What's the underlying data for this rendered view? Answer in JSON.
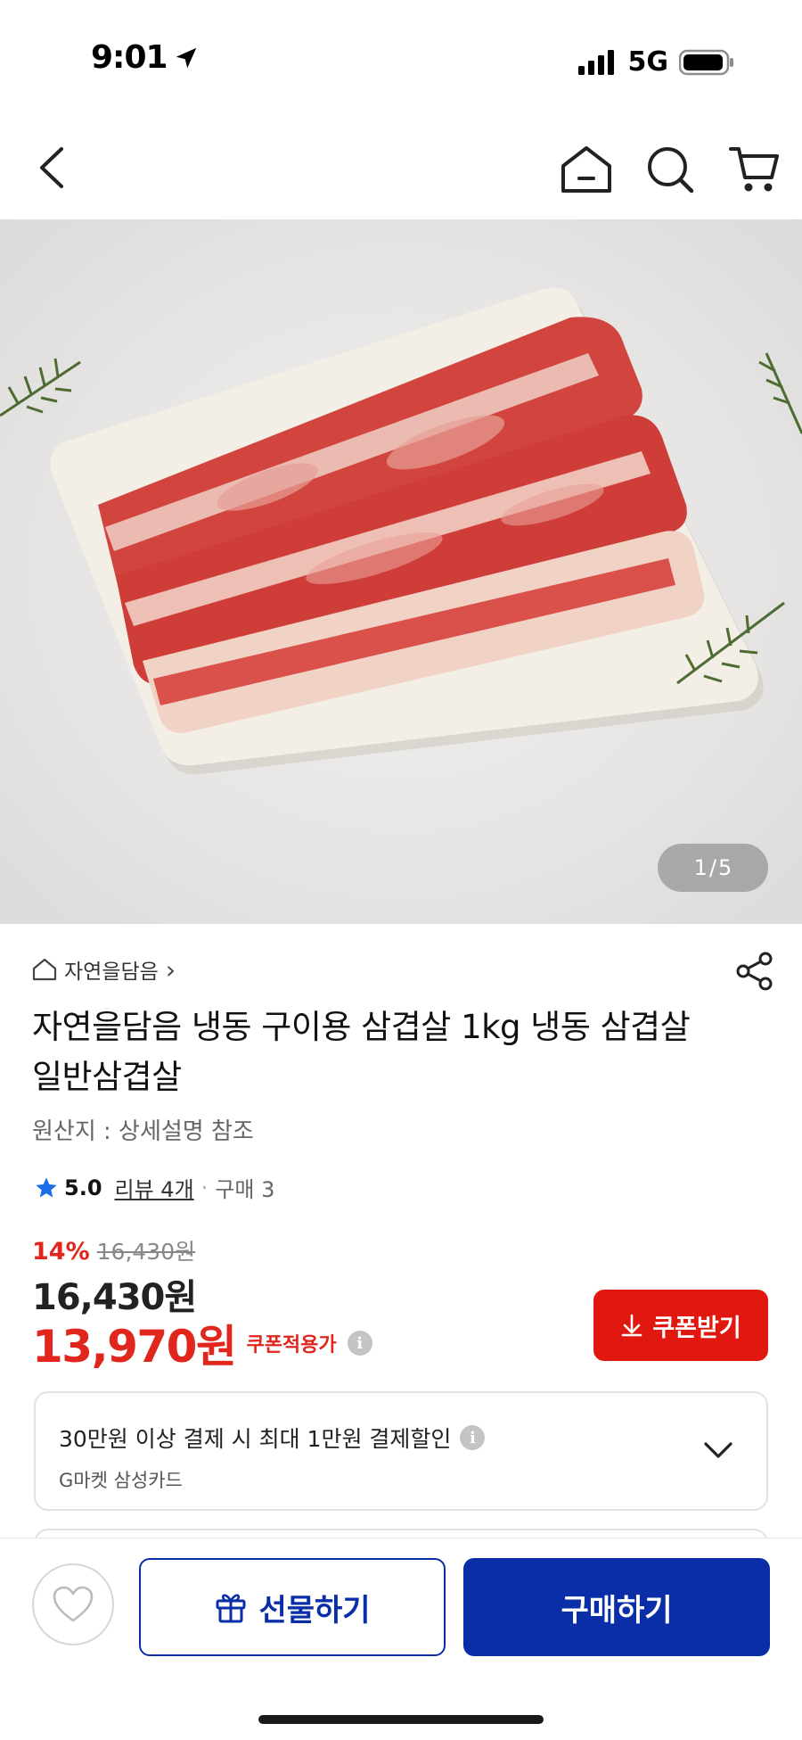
{
  "status_bar": {
    "time": "9:01",
    "network": "5G"
  },
  "product_image": {
    "counter_current": "1",
    "counter_separator": "/",
    "counter_total": "5"
  },
  "store": {
    "name": "자연을담음",
    "chevron": "›"
  },
  "product": {
    "title": "자연을담음 냉동 구이용 삼겹살 1kg 냉동 삼겹살 일반삼겹살",
    "origin": "원산지 : 상세설명 참조",
    "rating": "5.0",
    "reviews": "리뷰 4개",
    "separator": "·",
    "purchases": "구매 3"
  },
  "price": {
    "discount_rate": "14%",
    "original": "16,430원",
    "sale": "16,430원",
    "coupon_price": "13,970원",
    "coupon_applied_label": "쿠폰적용가",
    "info_glyph": "i"
  },
  "coupon_button": {
    "label": "쿠폰받기"
  },
  "card_promo": {
    "title": "30만원 이상 결제 시 최대 1만원 결제할인",
    "subtitle": "G마켓 삼성카드"
  },
  "bottom_bar": {
    "gift_label": "선물하기",
    "buy_label": "구매하기"
  },
  "colors": {
    "accent_red": "#e0180f",
    "brand_blue": "#0a2ea8"
  },
  "icons": {
    "back": "chevron-left-icon",
    "home": "home-icon",
    "search": "search-icon",
    "cart": "cart-icon",
    "share": "share-icon",
    "star": "star-icon",
    "download": "download-icon",
    "chevron_down": "chevron-down-icon",
    "heart": "heart-icon",
    "gift": "gift-icon"
  }
}
